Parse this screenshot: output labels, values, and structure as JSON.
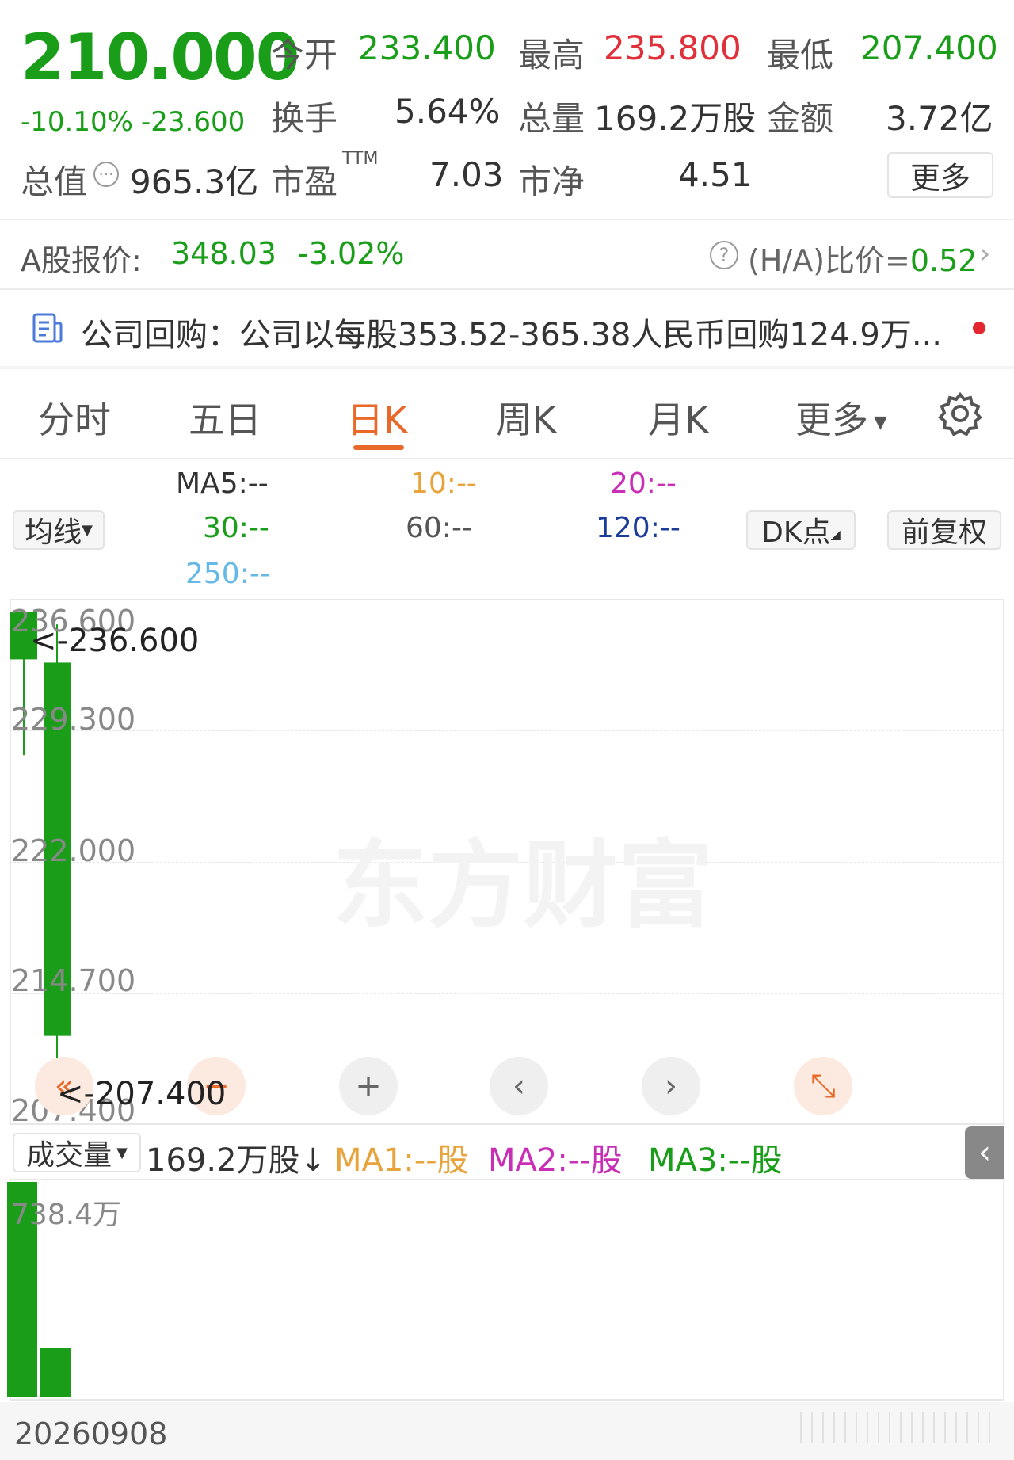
{
  "quote": {
    "price": "210.000",
    "change_pct": "-10.10%",
    "change_abs": "-23.600",
    "open_label": "今开",
    "open_value": "233.400",
    "high_label": "最高",
    "high_value": "235.800",
    "low_label": "最低",
    "low_value": "207.400",
    "turnover_label": "换手",
    "turnover_value": "5.64%",
    "volume_label": "总量",
    "volume_value": "169.2万股",
    "amount_label": "金额",
    "amount_value": "3.72亿",
    "mktcap_label": "总值",
    "mktcap_value": "965.3亿",
    "pe_label": "市盈",
    "pe_sup": "TTM",
    "pe_value": "7.03",
    "pb_label": "市净",
    "pb_value": "4.51",
    "more_button": "更多"
  },
  "ashare": {
    "label": "A股报价:",
    "price": "348.03",
    "change": "-3.02%",
    "ratio_label": "(H/A)比价=",
    "ratio_value": "0.52"
  },
  "announcement": {
    "text": "公司回购：公司以每股353.52-365.38人民币回购124.9万..."
  },
  "tabs": [
    "分时",
    "五日",
    "日K",
    "周K",
    "月K",
    "更多"
  ],
  "active_tab": "日K",
  "ma_legend": {
    "selector": "均线",
    "ma5": "MA5:--",
    "ma10": "10:--",
    "ma20": "20:--",
    "ma30": "30:--",
    "ma60": "60:--",
    "ma120": "120:--",
    "ma250": "250:--",
    "dk_button": "DK点",
    "adjust_button": "前复权"
  },
  "colors": {
    "down": "#1a9e1a",
    "up": "#e0303a",
    "accent": "#e8692a",
    "ma5": "#333333",
    "ma10": "#e8a33a",
    "ma20": "#c92fb6",
    "ma30": "#1a9e1a",
    "ma60": "#555555",
    "ma120": "#1b3d99",
    "ma250": "#66b8e6"
  },
  "chart_data": {
    "type": "candlestick",
    "y_ticks": [
      "236.600",
      "229.300",
      "222.000",
      "214.700",
      "207.400"
    ],
    "ylim": [
      207.4,
      236.6
    ],
    "high_marker": "<-236.600",
    "low_marker": "<-207.400",
    "watermark": "东方财富",
    "candles": [
      {
        "open": 236.6,
        "high": 236.6,
        "low": 227.6,
        "close": 233.6
      },
      {
        "open": 233.4,
        "high": 235.8,
        "low": 207.4,
        "close": 210.0
      }
    ],
    "volume": {
      "selector": "成交量",
      "total": "169.2万股↓",
      "ma1": "MA1:--股",
      "ma2": "MA2:--股",
      "ma3": "MA3:--股",
      "max_label": "738.4万",
      "max": 738.4,
      "values": [
        738.4,
        169.2
      ]
    },
    "x_label": "20260908"
  }
}
